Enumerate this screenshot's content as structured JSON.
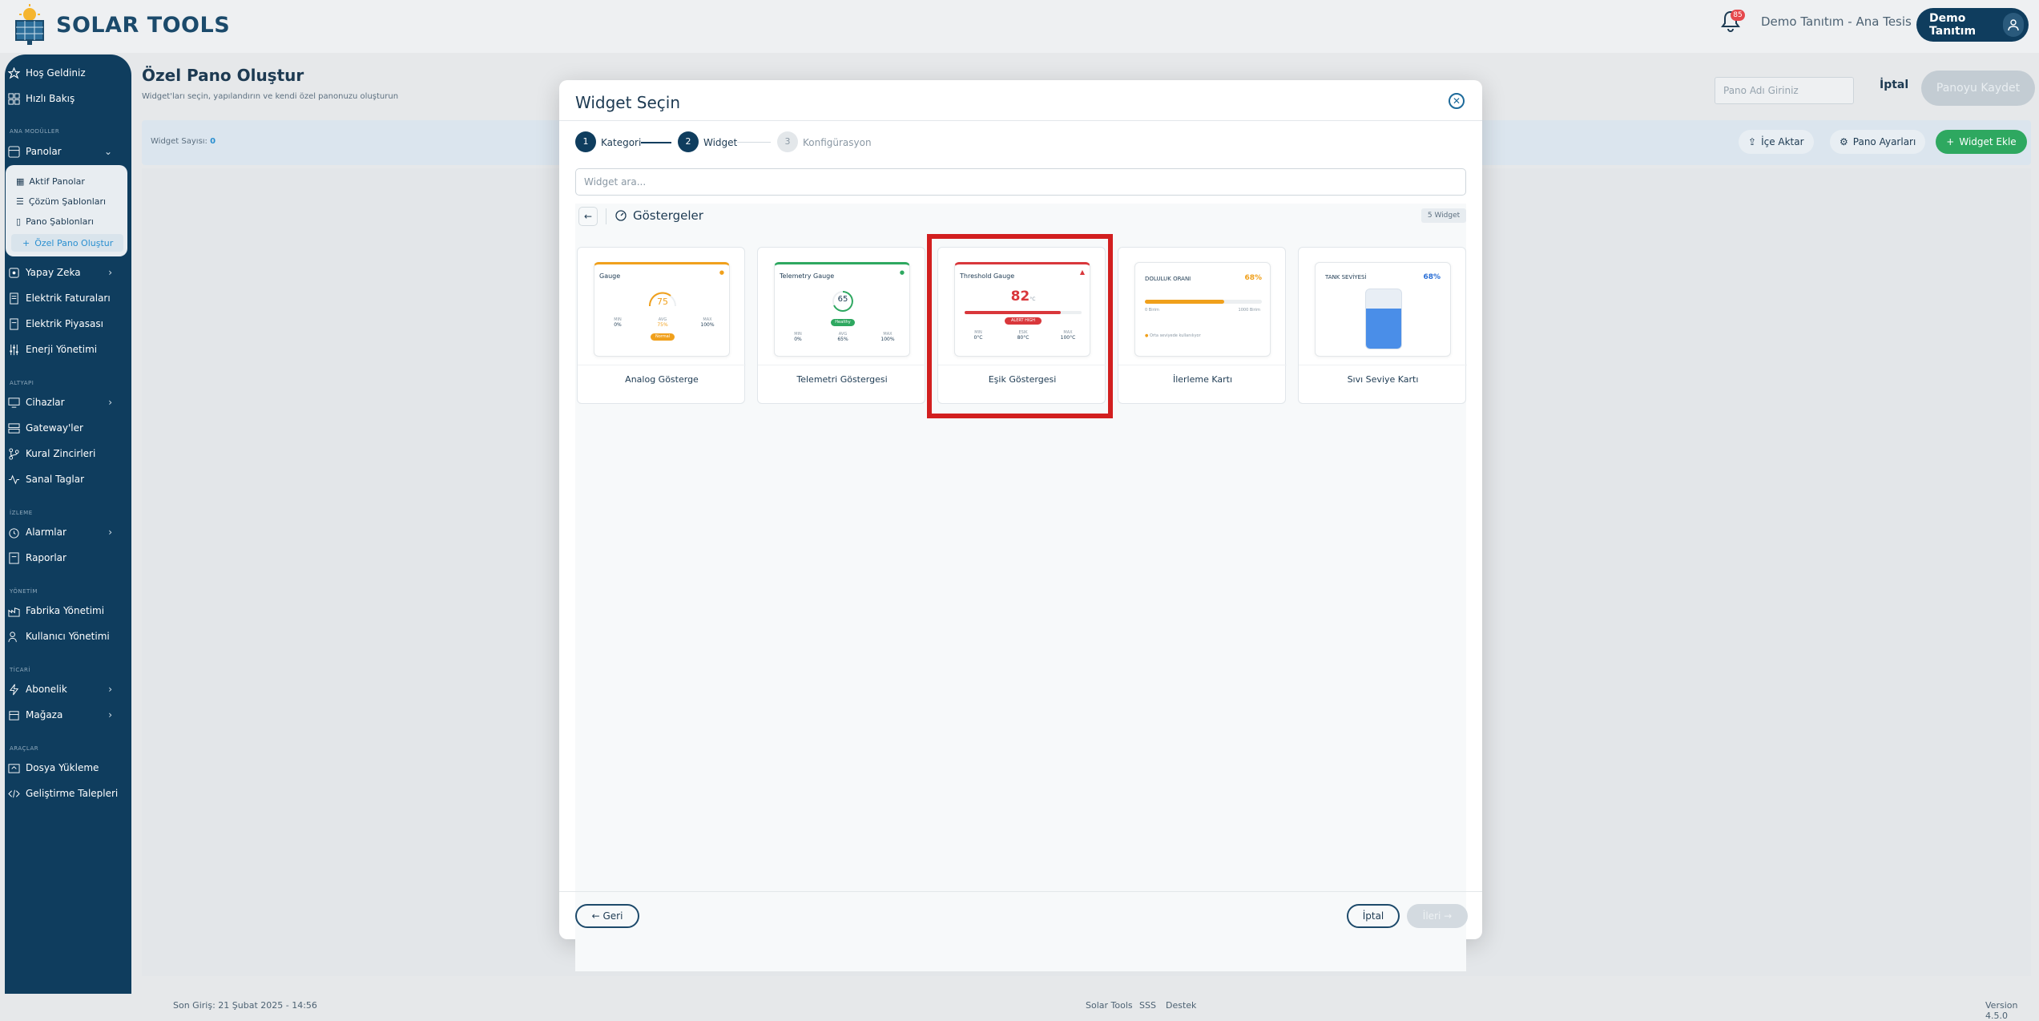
{
  "app": {
    "name": "SOLAR TOOLS"
  },
  "header": {
    "notification_count": "85",
    "tenant": "Demo Tanıtım - Ana Tesis",
    "user": "Demo Tanıtım"
  },
  "sidebar": {
    "items": [
      {
        "label": "Hoş Geldiniz"
      },
      {
        "label": "Hızlı Bakış"
      }
    ],
    "sections": {
      "ana": "ANA MODÜLLER",
      "altyapi": "ALTYAPI",
      "izleme": "İZLEME",
      "yonetim": "YÖNETİM",
      "ticari": "TİCARİ",
      "araclar": "ARAÇLAR"
    },
    "panolar": "Panolar",
    "sub": [
      "Aktif Panolar",
      "Çözüm Şablonları",
      "Pano Şablonları",
      "Özel Pano Oluştur"
    ],
    "ana_items": [
      "Yapay Zeka",
      "Elektrik Faturaları",
      "Elektrik Piyasası",
      "Enerji Yönetimi"
    ],
    "altyapi_items": [
      "Cihazlar",
      "Gateway'ler",
      "Kural Zincirleri",
      "Sanal Taglar"
    ],
    "izleme_items": [
      "Alarmlar",
      "Raporlar"
    ],
    "yonetim_items": [
      "Fabrika Yönetimi",
      "Kullanıcı Yönetimi"
    ],
    "ticari_items": [
      "Abonelik",
      "Mağaza"
    ],
    "araclar_items": [
      "Dosya Yükleme",
      "Geliştirme Talepleri"
    ]
  },
  "page": {
    "title": "Özel Pano Oluştur",
    "subtitle": "Widget'ları seçin, yapılandırın ve kendi özel panonuzu oluşturun",
    "name_placeholder": "Pano Adı Giriniz",
    "cancel": "İptal",
    "save": "Panoyu Kaydet",
    "widget_count_label": "Widget Sayısı:",
    "widget_count": "0",
    "import": "İçe Aktar",
    "settings": "Pano Ayarları",
    "add_widget": "Widget Ekle"
  },
  "modal": {
    "title": "Widget Seçin",
    "steps": [
      {
        "num": "1",
        "label": "Kategori"
      },
      {
        "num": "2",
        "label": "Widget"
      },
      {
        "num": "3",
        "label": "Konfigürasyon"
      }
    ],
    "search_placeholder": "Widget ara...",
    "category": "Göstergeler",
    "category_count": "5 Widget",
    "cards": [
      {
        "name": "Analog Gösterge",
        "preview_title": "Gauge",
        "value": "75",
        "stats": [
          [
            "MIN",
            "0%"
          ],
          [
            "AVG",
            "75%"
          ],
          [
            "MAX",
            "100%"
          ]
        ],
        "badge": "Normal"
      },
      {
        "name": "Telemetri Göstergesi",
        "preview_title": "Telemetry Gauge",
        "value": "65",
        "stats": [
          [
            "MIN",
            "0%"
          ],
          [
            "AVG",
            "65%"
          ],
          [
            "MAX",
            "100%"
          ]
        ],
        "badge": "Healthy"
      },
      {
        "name": "Eşik Göstergesi",
        "preview_title": "Threshold Gauge",
        "value": "82",
        "unit": "°C",
        "stats": [
          [
            "MIN",
            "0°C"
          ],
          [
            "ESIK",
            "80°C"
          ],
          [
            "MAX",
            "100°C"
          ]
        ],
        "badge": "ALERT HIGH"
      },
      {
        "name": "İlerleme Kartı",
        "preview_title": "DOLULUK ORANI",
        "value": "68%",
        "progress": 0.68,
        "min_label": "0 Birim",
        "max_label": "1000 Birim",
        "note": "Orta seviyede kullanılıyor"
      },
      {
        "name": "Sıvı Seviye Kartı",
        "preview_title": "TANK SEVİYESİ",
        "value": "68%",
        "level": 0.68
      }
    ],
    "back": "← Geri",
    "cancel": "İptal",
    "next": "İleri →"
  },
  "footer": {
    "last_login": "Son Giriş: 21 Şubat 2025 - 14:56",
    "links": [
      "Solar Tools",
      "SSS",
      "Destek"
    ],
    "version": "Version 4.5.0"
  },
  "colors": {
    "primary": "#0f3d5e",
    "accent_green": "#2ea860",
    "highlight": "#d21f1f",
    "alert": "#d9373b",
    "warn": "#f0a01c"
  }
}
